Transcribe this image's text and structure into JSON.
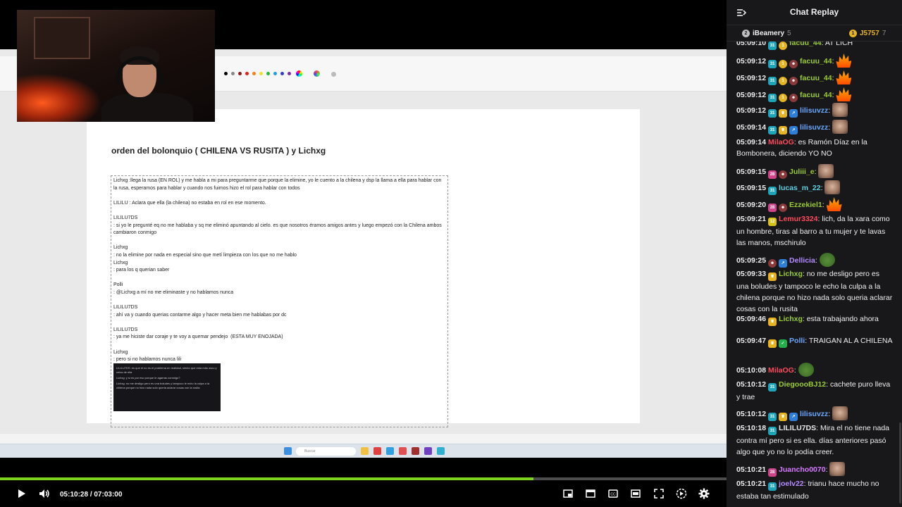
{
  "player": {
    "current_time": "05:10:28",
    "separator": "/",
    "duration": "07:03:00",
    "progress_fraction": 0.734
  },
  "document": {
    "title": "orden del bolonquio ( CHILENA VS RUSITA ) y Lichxg",
    "lines": [
      "Lichxg :llega la rusa (EN ROL) y me habla a mi para preguntarme que porque la elimine, yo le cuento a la chilena y dsp la llama a ella para hablar con la rusa, esperamos para hablar y cuando nos fuimos hizo el rol para hablar con todos",
      "",
      "LILILU : Aclara que ella (la chilena) no estaba en rol en ese momento.",
      "",
      "LILILU7DS",
      ": si yo le pregunté eq no me hablaba y sq me eliminó apuntando al cielo. es que nosotros éramos amigos antes y luego empezó con la Chilena ambos cambiaron conmigo",
      "",
      "Lichxg",
      ": no la elimine por nada en especial sino que metí limpieza con los que no me hablo",
      "Lichxg",
      ": para los q querian saber",
      "",
      "Polli",
      ": @Lichxg a mí no me eliminaste y no hablamos nunca",
      "",
      "LILILU7DS",
      ": ahí va y cuando querias contarme algo y hacer meta bien me hablabas por dc",
      "",
      "LILILU7DS",
      ": ya me hiciste dar coraje y te voy a quemar pendejo  (ESTA MUY ENOJADA)",
      "",
      "Lichxg",
      ": pero si no hablamos nunca lili"
    ],
    "embed_lines": [
      "LILILU7DS: es que el no es el problema en realidad, siento que esta más oscu y celos de ella",
      "Lichxg: y si es por eso porque le agarras conmigo?",
      "Lichxg: no me desligo pero es una boludes y tampoco le echo la culpa a la chilena porque no hizo nada solo queria aclarar cosas con la rusita"
    ],
    "taskbar_search": "Buscar"
  },
  "chat": {
    "title": "Chat Replay",
    "leaderboard": [
      {
        "rank": "2",
        "name": "iBeamery",
        "count": "5",
        "color": "#bfbfbf"
      },
      {
        "rank": "1",
        "name": "J5757",
        "count": "7",
        "color": "#e6b422"
      }
    ],
    "messages": [
      {
        "ts": "05:09:10",
        "user": "facuu_44",
        "color": "#9acd32",
        "text": ": AT LICH",
        "badges": [
          "sub-teal",
          "gold"
        ],
        "emote": ""
      },
      {
        "ts": "05:09:12",
        "user": "facuu_44",
        "color": "#9acd32",
        "text": ":",
        "badges": [
          "sub-teal",
          "gold",
          "avatar"
        ],
        "emote": "fire"
      },
      {
        "ts": "05:09:12",
        "user": "facuu_44",
        "color": "#9acd32",
        "text": ":",
        "badges": [
          "sub-teal",
          "gold",
          "avatar"
        ],
        "emote": "fire"
      },
      {
        "ts": "05:09:12",
        "user": "facuu_44",
        "color": "#9acd32",
        "text": ":",
        "badges": [
          "sub-teal",
          "gold",
          "avatar"
        ],
        "emote": "fire"
      },
      {
        "ts": "05:09:12",
        "user": "lilisuvzz",
        "color": "#6aa9ff",
        "text": ":",
        "badges": [
          "sub-teal",
          "crown",
          "arrow"
        ],
        "emote": "face"
      },
      {
        "ts": "05:09:14",
        "user": "lilisuvzz",
        "color": "#6aa9ff",
        "text": ":",
        "badges": [
          "sub-teal",
          "crown",
          "arrow"
        ],
        "emote": "face"
      },
      {
        "ts": "05:09:14",
        "user": "MilaOG",
        "color": "#ff4b5c",
        "text": ": es Ramón Díaz en la Bombonera, diciendo YO NO",
        "badges": [],
        "emote": ""
      },
      {
        "ts": "05:09:15",
        "user": "Juliii_e",
        "color": "#9acd32",
        "text": ":",
        "badges": [
          "sub-pink",
          "avatar"
        ],
        "emote": "face"
      },
      {
        "ts": "05:09:15",
        "user": "lucas_m_22",
        "color": "#5fd0e0",
        "text": ":",
        "badges": [
          "sub-teal"
        ],
        "emote": "face"
      },
      {
        "ts": "05:09:20",
        "user": "Ezzekiel1",
        "color": "#9acd32",
        "text": ":",
        "badges": [
          "sub-pink",
          "avatar"
        ],
        "emote": "fire"
      },
      {
        "ts": "05:09:21",
        "user": "Lemur3324",
        "color": "#ff4b5c",
        "text": ": lich, da la xara como un hombre, tiras al barro a tu mujer y te lavas las manos, mschirulo",
        "badges": [
          "sub-yellow"
        ],
        "emote": ""
      },
      {
        "ts": "05:09:25",
        "user": "Dellicia",
        "color": "#b58bff",
        "text": ":",
        "badges": [
          "avatar",
          "arrow"
        ],
        "emote": "pepe"
      },
      {
        "ts": "05:09:33",
        "user": "Lichxg",
        "color": "#9acd32",
        "text": ": no me desligo pero es una boludes y tampoco le echo la culpa a la chilena porque no hizo nada solo queria aclarar cosas con la rusita",
        "badges": [
          "crown"
        ],
        "emote": ""
      },
      {
        "ts": "05:09:46",
        "user": "Lichxg",
        "color": "#9acd32",
        "text": ": esta trabajando ahora",
        "badges": [
          "crown"
        ],
        "emote": ""
      },
      {
        "ts": "05:09:47",
        "user": "Polli",
        "color": "#6aa9ff",
        "text": ": TRAIGAN AL A CHILENA",
        "badges": [
          "crown",
          "verified"
        ],
        "emote": ""
      },
      {
        "ts": "05:10:08",
        "user": "MilaOG",
        "color": "#ff4b5c",
        "text": ":",
        "badges": [],
        "emote": "pepe"
      },
      {
        "ts": "05:10:12",
        "user": "DiegoooBJ12",
        "color": "#9acd32",
        "text": ": cachete puro lleva y trae",
        "badges": [
          "sub-teal"
        ],
        "emote": ""
      },
      {
        "ts": "05:10:12",
        "user": "lilisuvzz",
        "color": "#6aa9ff",
        "text": ":",
        "badges": [
          "sub-teal",
          "crown",
          "arrow"
        ],
        "emote": "face"
      },
      {
        "ts": "05:10:18",
        "user": "LILILU7DS",
        "color": "#e8e8e8",
        "text": ": Mira el no tiene nada contra mí pero si es ella. días anteriores pasó algo que yo no lo podía creer.",
        "badges": [
          "sub-teal"
        ],
        "emote": ""
      },
      {
        "ts": "05:10:21",
        "user": "Juancho0070",
        "color": "#d67bff",
        "text": ":",
        "badges": [
          "sub-pink"
        ],
        "emote": "face"
      },
      {
        "ts": "05:10:21",
        "user": "joelv22",
        "color": "#b58bff",
        "text": ": trianu hace mucho no estaba tan estimulado",
        "badges": [
          "sub-teal"
        ],
        "emote": ""
      }
    ]
  },
  "colors": {
    "progress": "#7dd11f",
    "chat_bg": "#18181b"
  }
}
